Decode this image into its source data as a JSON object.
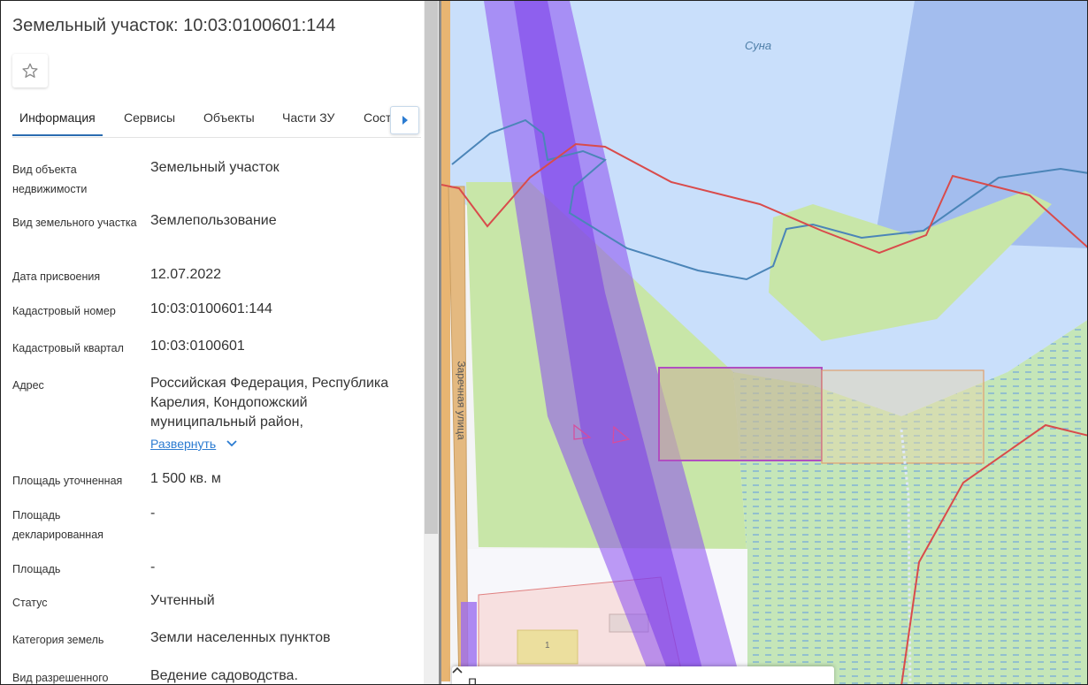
{
  "title": "Земельный участок: 10:03:0100601:144",
  "favorite_icon": "star-icon",
  "tabs": [
    {
      "label": "Информация",
      "active": true
    },
    {
      "label": "Сервисы"
    },
    {
      "label": "Объекты"
    },
    {
      "label": "Части ЗУ"
    },
    {
      "label": "Сост"
    }
  ],
  "tab_next_icon": "chevron-right-icon",
  "properties": [
    {
      "label": "Вид объекта недвижимости",
      "value": "Земельный участок"
    },
    {
      "label": "Вид земельного участка",
      "value": "Землепользование"
    },
    {
      "label": "Дата присвоения",
      "value": "12.07.2022"
    },
    {
      "label": "Кадастровый номер",
      "value": "10:03:0100601:144"
    },
    {
      "label": "Кадастровый квартал",
      "value": "10:03:0100601"
    },
    {
      "label": "Адрес",
      "value": "Российская Федерация, Республика Карелия, Кондопожский муниципальный район,"
    },
    {
      "label": "Площадь уточненная",
      "value": "1 500 кв. м"
    },
    {
      "label": "Площадь декларированная",
      "value": "-"
    },
    {
      "label": "Площадь",
      "value": "-"
    },
    {
      "label": "Статус",
      "value": "Учтенный"
    },
    {
      "label": "Категория земель",
      "value": "Земли населенных пунктов"
    },
    {
      "label": "Вид разрешенного",
      "value": "Ведение садоводства."
    }
  ],
  "expand_link": "Развернуть",
  "map": {
    "water_label": "Суна",
    "street_label": "Заречная улица",
    "building_number": "1",
    "bottom_card_text": "П",
    "colors": {
      "water": "#c9dffb",
      "water_dark": "#9eb8ec",
      "grass": "#c8e6a8",
      "marsh": "#a9d8b0",
      "corridor": "#8a4cf0",
      "boundary_red": "#d94b4b",
      "boundary_blue": "#4b85b8",
      "selected_parcel": "#b04fc0",
      "road": "#e8b572"
    }
  }
}
